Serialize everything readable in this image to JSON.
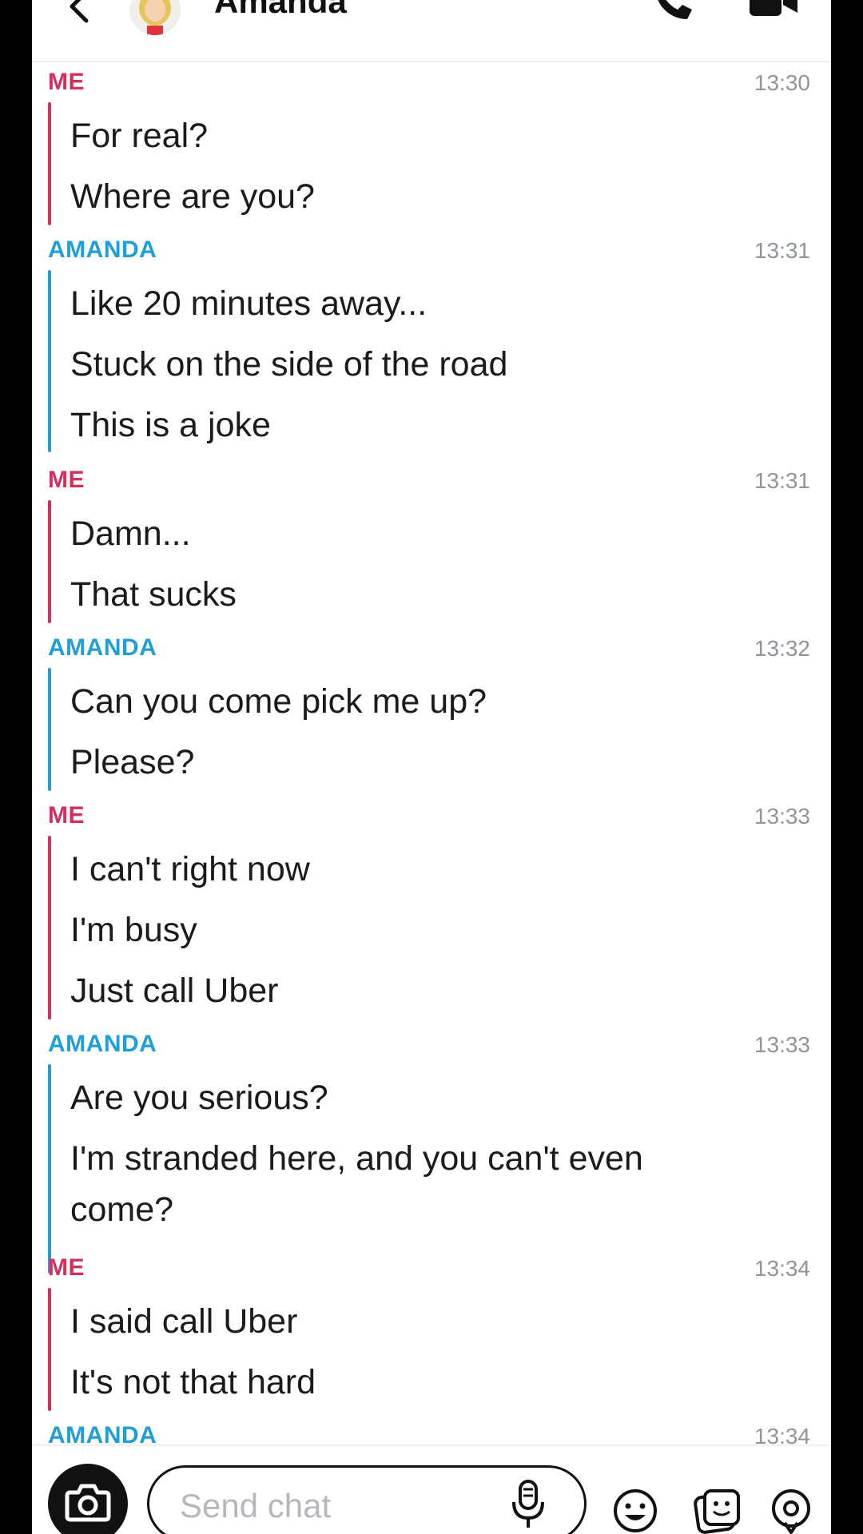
{
  "header": {
    "title": "Amanda"
  },
  "messages": [
    {
      "sender": "ME",
      "time": "13:30",
      "lines": [
        "For real?",
        "Where are you?"
      ]
    },
    {
      "sender": "AMANDA",
      "time": "13:31",
      "lines": [
        "Like 20 minutes away...",
        "Stuck on the side of the road",
        "This is a joke"
      ]
    },
    {
      "sender": "ME",
      "time": "13:31",
      "lines": [
        "Damn...",
        "That sucks"
      ]
    },
    {
      "sender": "AMANDA",
      "time": "13:32",
      "lines": [
        "Can you come pick me up?",
        "Please?"
      ]
    },
    {
      "sender": "ME",
      "time": "13:33",
      "lines": [
        "I can't right now",
        "I'm busy",
        "Just call Uber"
      ]
    },
    {
      "sender": "AMANDA",
      "time": "13:33",
      "lines": [
        "Are you serious?",
        "I'm stranded here, and you can't even",
        "come?"
      ]
    },
    {
      "sender": "ME",
      "time": "13:34",
      "lines": [
        "I said call Uber",
        "It's not that hard"
      ]
    },
    {
      "sender": "AMANDA",
      "time": "13:34",
      "lines": []
    }
  ],
  "composer": {
    "placeholder": "Send chat"
  },
  "colors": {
    "me": "#d62f5c",
    "them": "#1f9ed8"
  },
  "icons": [
    "back-icon",
    "call-icon",
    "video-icon",
    "camera-icon",
    "mic-icon",
    "emoji-icon",
    "sticker-icon",
    "location-icon"
  ]
}
